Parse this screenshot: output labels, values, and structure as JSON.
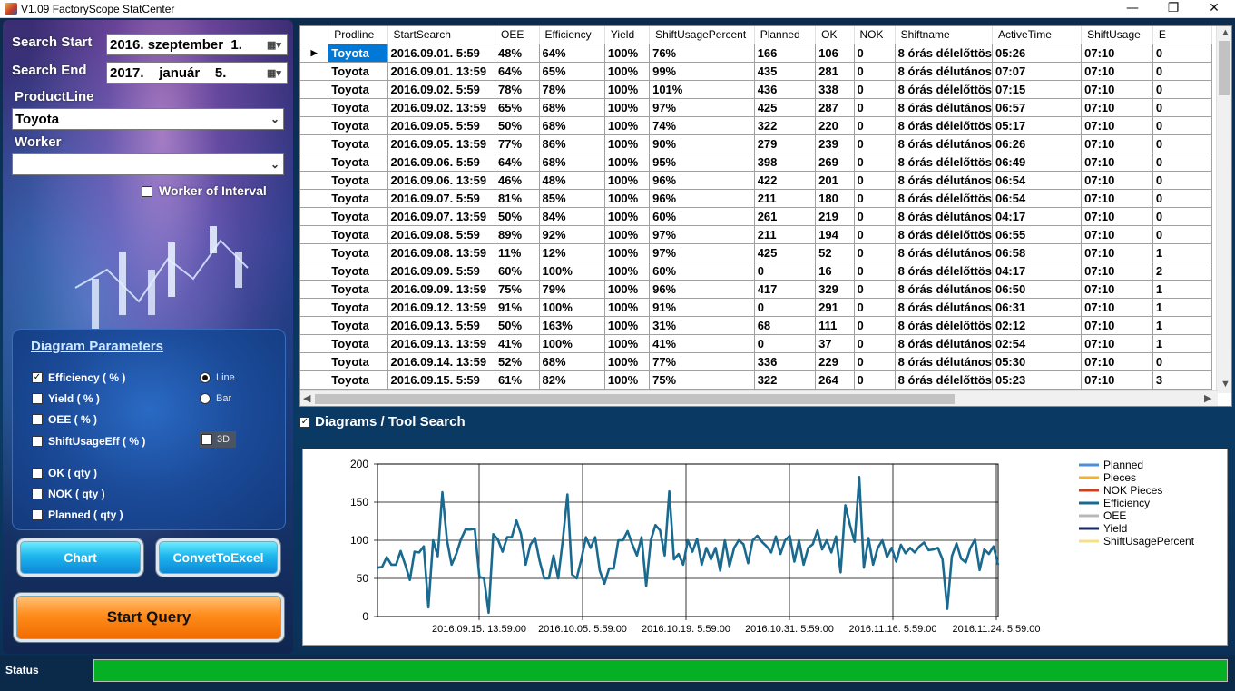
{
  "window": {
    "title": "V1.09 FactoryScope StatCenter",
    "minimize": "—",
    "maximize": "❐",
    "close": "✕"
  },
  "filters": {
    "search_start_label": "Search Start",
    "search_start_value": "2016. szeptember  1.",
    "search_end_label": "Search End",
    "search_end_value": "2017.    január    5.",
    "productline_label": "ProductLine",
    "productline_value": "Toyota",
    "worker_label": "Worker",
    "worker_value": "",
    "worker_interval_label": "Worker of Interval",
    "worker_interval_checked": false
  },
  "diagram_parameters": {
    "heading": "Diagram Parameters",
    "checkboxes": [
      {
        "label": "Efficiency ( % )",
        "checked": true
      },
      {
        "label": "Yield ( % )",
        "checked": false
      },
      {
        "label": "OEE ( % )",
        "checked": false
      },
      {
        "label": "ShiftUsageEff ( % )",
        "checked": false
      },
      {
        "label": "OK ( qty )",
        "checked": false
      },
      {
        "label": "NOK ( qty )",
        "checked": false
      },
      {
        "label": "Planned ( qty )",
        "checked": false
      }
    ],
    "radio_line": "Line",
    "radio_bar": "Bar",
    "selected_mode": "Line",
    "check_3d": "3D",
    "check_3d_checked": false
  },
  "buttons": {
    "chart": "Chart",
    "excel": "ConvetToExcel",
    "query": "Start Query"
  },
  "table": {
    "columns": [
      "Prodline",
      "StartSearch",
      "OEE",
      "Efficiency",
      "Yield",
      "ShiftUsagePercent",
      "Planned",
      "OK",
      "NOK",
      "Shiftname",
      "ActiveTime",
      "ShiftUsage",
      "E"
    ],
    "selected_row": 0,
    "rows": [
      [
        "Toyota",
        "2016.09.01. 5:59",
        "48%",
        "64%",
        "100%",
        "76%",
        "166",
        "106",
        "0",
        "8 órás délelőttös",
        "05:26",
        "07:10",
        "0"
      ],
      [
        "Toyota",
        "2016.09.01. 13:59",
        "64%",
        "65%",
        "100%",
        "99%",
        "435",
        "281",
        "0",
        "8 órás délutános",
        "07:07",
        "07:10",
        "0"
      ],
      [
        "Toyota",
        "2016.09.02. 5:59",
        "78%",
        "78%",
        "100%",
        "101%",
        "436",
        "338",
        "0",
        "8 órás délelőttös",
        "07:15",
        "07:10",
        "0"
      ],
      [
        "Toyota",
        "2016.09.02. 13:59",
        "65%",
        "68%",
        "100%",
        "97%",
        "425",
        "287",
        "0",
        "8 órás délutános",
        "06:57",
        "07:10",
        "0"
      ],
      [
        "Toyota",
        "2016.09.05. 5:59",
        "50%",
        "68%",
        "100%",
        "74%",
        "322",
        "220",
        "0",
        "8 órás délelőttös",
        "05:17",
        "07:10",
        "0"
      ],
      [
        "Toyota",
        "2016.09.05. 13:59",
        "77%",
        "86%",
        "100%",
        "90%",
        "279",
        "239",
        "0",
        "8 órás délutános",
        "06:26",
        "07:10",
        "0"
      ],
      [
        "Toyota",
        "2016.09.06. 5:59",
        "64%",
        "68%",
        "100%",
        "95%",
        "398",
        "269",
        "0",
        "8 órás délelőttös",
        "06:49",
        "07:10",
        "0"
      ],
      [
        "Toyota",
        "2016.09.06. 13:59",
        "46%",
        "48%",
        "100%",
        "96%",
        "422",
        "201",
        "0",
        "8 órás délutános",
        "06:54",
        "07:10",
        "0"
      ],
      [
        "Toyota",
        "2016.09.07. 5:59",
        "81%",
        "85%",
        "100%",
        "96%",
        "211",
        "180",
        "0",
        "8 órás délelőttös",
        "06:54",
        "07:10",
        "0"
      ],
      [
        "Toyota",
        "2016.09.07. 13:59",
        "50%",
        "84%",
        "100%",
        "60%",
        "261",
        "219",
        "0",
        "8 órás délutános",
        "04:17",
        "07:10",
        "0"
      ],
      [
        "Toyota",
        "2016.09.08. 5:59",
        "89%",
        "92%",
        "100%",
        "97%",
        "211",
        "194",
        "0",
        "8 órás délelőttös",
        "06:55",
        "07:10",
        "0"
      ],
      [
        "Toyota",
        "2016.09.08. 13:59",
        "11%",
        "12%",
        "100%",
        "97%",
        "425",
        "52",
        "0",
        "8 órás délutános",
        "06:58",
        "07:10",
        "1"
      ],
      [
        "Toyota",
        "2016.09.09. 5:59",
        "60%",
        "100%",
        "100%",
        "60%",
        "0",
        "16",
        "0",
        "8 órás délelőttös",
        "04:17",
        "07:10",
        "2"
      ],
      [
        "Toyota",
        "2016.09.09. 13:59",
        "75%",
        "79%",
        "100%",
        "96%",
        "417",
        "329",
        "0",
        "8 órás délutános",
        "06:50",
        "07:10",
        "1"
      ],
      [
        "Toyota",
        "2016.09.12. 13:59",
        "91%",
        "100%",
        "100%",
        "91%",
        "0",
        "291",
        "0",
        "8 órás délutános",
        "06:31",
        "07:10",
        "1"
      ],
      [
        "Toyota",
        "2016.09.13. 5:59",
        "50%",
        "163%",
        "100%",
        "31%",
        "68",
        "111",
        "0",
        "8 órás délelőttös",
        "02:12",
        "07:10",
        "1"
      ],
      [
        "Toyota",
        "2016.09.13. 13:59",
        "41%",
        "100%",
        "100%",
        "41%",
        "0",
        "37",
        "0",
        "8 órás délutános",
        "02:54",
        "07:10",
        "1"
      ],
      [
        "Toyota",
        "2016.09.14. 13:59",
        "52%",
        "68%",
        "100%",
        "77%",
        "336",
        "229",
        "0",
        "8 órás délutános",
        "05:30",
        "07:10",
        "0"
      ],
      [
        "Toyota",
        "2016.09.15. 5:59",
        "61%",
        "82%",
        "100%",
        "75%",
        "322",
        "264",
        "0",
        "8 órás délelőttös",
        "05:23",
        "07:10",
        "3"
      ]
    ]
  },
  "diagram_section": {
    "title": "Diagrams / Tool Search",
    "checked": true
  },
  "chart_data": {
    "type": "line",
    "ylim": [
      0,
      200
    ],
    "yticks": [
      0,
      50,
      100,
      150,
      200
    ],
    "xtick_labels": [
      "2016.09.15. 13:59:00",
      "2016.10.05. 5:59:00",
      "2016.10.19. 5:59:00",
      "2016.10.31. 5:59:00",
      "2016.11.16. 5:59:00",
      "2016.11.24. 5:59:00"
    ],
    "legend": [
      {
        "name": "Planned",
        "color": "#4a90d9"
      },
      {
        "name": "Pieces",
        "color": "#f0b030"
      },
      {
        "name": "NOK Pieces",
        "color": "#d04020"
      },
      {
        "name": "Efficiency",
        "color": "#1a6a90"
      },
      {
        "name": "OEE",
        "color": "#b8b8b8"
      },
      {
        "name": "Yield",
        "color": "#1a2a60"
      },
      {
        "name": "ShiftUsagePercent",
        "color": "#f4e08a"
      }
    ],
    "grid": true,
    "legend_position": "right",
    "series": [
      {
        "name": "Efficiency",
        "color": "#1a6a90",
        "values": [
          64,
          65,
          78,
          68,
          68,
          86,
          68,
          48,
          85,
          84,
          92,
          12,
          100,
          79,
          163,
          100,
          68,
          82,
          101,
          114,
          114,
          115,
          52,
          50,
          5,
          108,
          101,
          85,
          104,
          104,
          126,
          108,
          68,
          94,
          103,
          73,
          50,
          50,
          80,
          50,
          100,
          160,
          55,
          50,
          75,
          104,
          90,
          104,
          60,
          43,
          63,
          63,
          100,
          100,
          112,
          95,
          80,
          104,
          40,
          100,
          120,
          113,
          80,
          164,
          75,
          82,
          68,
          100,
          85,
          102,
          68,
          90,
          75,
          90,
          60,
          100,
          66,
          90,
          100,
          95,
          70,
          100,
          106,
          98,
          92,
          84,
          105,
          82,
          100,
          106,
          72,
          100,
          68,
          90,
          95,
          113,
          88,
          100,
          84,
          105,
          58,
          146,
          120,
          98,
          183,
          64,
          103,
          68,
          90,
          100,
          78,
          90,
          72,
          94,
          83,
          90,
          84,
          92,
          97,
          87,
          88,
          90,
          75,
          10,
          79,
          96,
          76,
          71,
          90,
          101,
          61,
          88,
          82,
          92,
          68
        ]
      }
    ]
  },
  "status": {
    "label": "Status",
    "progress": 1.0
  }
}
